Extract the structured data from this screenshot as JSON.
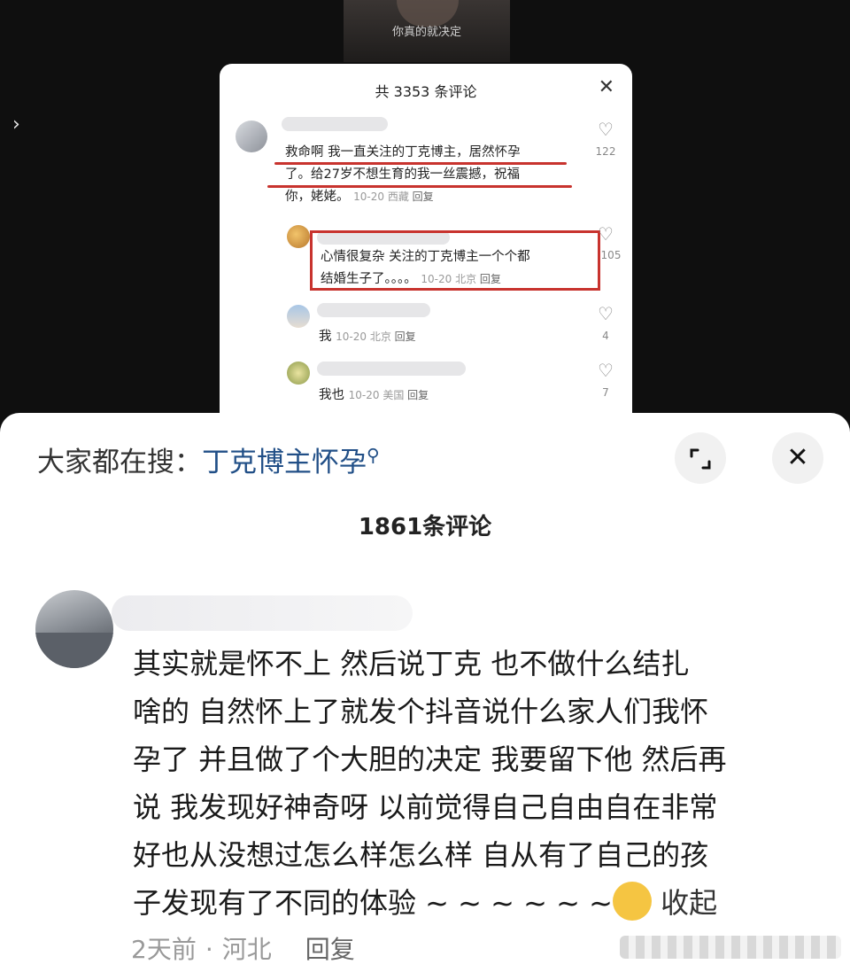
{
  "background": {
    "caption": "你真的就决定"
  },
  "inner_panel": {
    "title": "共 3353 条评论",
    "comments": [
      {
        "text": "救命啊 我一直关注的丁克博主，居然怀孕了。给27岁不想生育的我一丝震撼，祝福你，姥姥。",
        "line1": "救命啊 我一直关注的丁克博主，居然怀孕",
        "line2": "了。给27岁不想生育的我一丝震撼，祝福",
        "line3": "你，姥姥。",
        "date": "10-20",
        "location": "西藏",
        "reply": "回复",
        "likes": "122"
      },
      {
        "line1": "心情很复杂 关注的丁克博主一个个都",
        "line2": "结婚生子了。。。。",
        "date": "10-20",
        "location": "北京",
        "reply": "回复",
        "likes": "105"
      },
      {
        "text": "我",
        "date": "10-20",
        "location": "北京",
        "reply": "回复",
        "likes": "4"
      },
      {
        "text": "我也",
        "date": "10-20",
        "location": "美国",
        "reply": "回复",
        "likes": "7"
      }
    ]
  },
  "search_bar": {
    "prefix": "大家都在搜：",
    "keyword": "丁克博主怀孕"
  },
  "comments_title": "1861条评论",
  "main_comment": {
    "lines": "其实就是怀不上  然后说丁克   也不做什么结扎\n啥的  自然怀上了就发个抖音说什么家人们我怀\n孕了 并且做了个大胆的决定 我要留下他 然后再\n说 我发现好神奇呀 以前觉得自己自由自在非常\n好也从没想过怎么样怎么样 自从有了自己的孩\n子发现有了不同的体验  ~ ~ ~ ~ ~ ~",
    "collapse": "收起",
    "time": "2天前",
    "separator": "·",
    "location": "河北",
    "reply": "回复"
  },
  "colors": {
    "highlight_red": "#c8332e",
    "link_blue": "#214f87"
  }
}
